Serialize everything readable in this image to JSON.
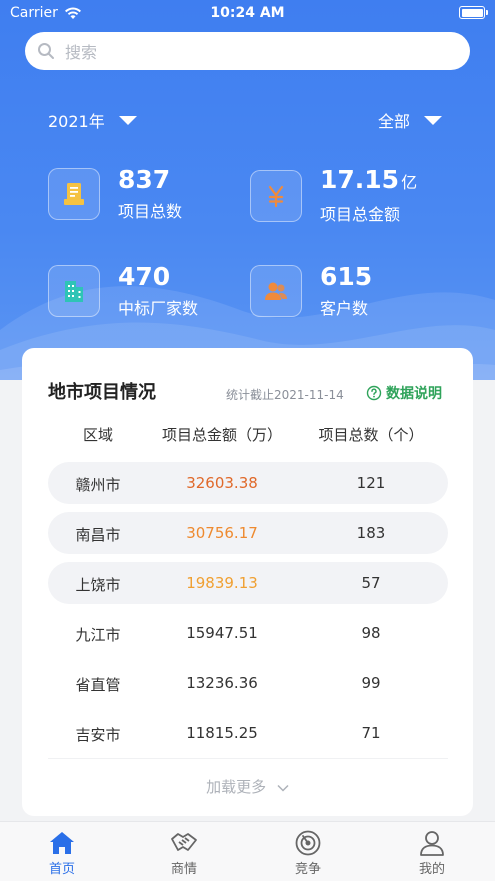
{
  "status_bar": {
    "carrier": "Carrier",
    "time": "10:24 AM"
  },
  "search": {
    "placeholder": "搜索"
  },
  "filters": {
    "year": "2021年",
    "scope": "全部"
  },
  "stats": [
    {
      "value": "837",
      "unit": "",
      "label": "项目总数",
      "icon": "document-icon",
      "color": "#f5c242"
    },
    {
      "value": "17.15",
      "unit": "亿",
      "label": "项目总金额",
      "icon": "yuan-icon",
      "color": "#f08a3c"
    },
    {
      "value": "470",
      "unit": "",
      "label": "中标厂家数",
      "icon": "building-icon",
      "color": "#2ec4b6"
    },
    {
      "value": "615",
      "unit": "",
      "label": "客户数",
      "icon": "users-icon",
      "color": "#f08a3c"
    }
  ],
  "card": {
    "title": "地市项目情况",
    "date": "统计截止2021-11-14",
    "help": "数据说明",
    "columns": [
      "区域",
      "项目总金额（万）",
      "项目总数（个）"
    ],
    "rows": [
      {
        "region": "赣州市",
        "amount": "32603.38",
        "count": "121"
      },
      {
        "region": "南昌市",
        "amount": "30756.17",
        "count": "183"
      },
      {
        "region": "上饶市",
        "amount": "19839.13",
        "count": "57"
      },
      {
        "region": "九江市",
        "amount": "15947.51",
        "count": "98"
      },
      {
        "region": "省直管",
        "amount": "13236.36",
        "count": "99"
      },
      {
        "region": "吉安市",
        "amount": "11815.25",
        "count": "71"
      }
    ],
    "load_more": "加载更多"
  },
  "tabs": [
    {
      "label": "首页",
      "icon": "home-icon",
      "active": true
    },
    {
      "label": "商情",
      "icon": "handshake-icon",
      "active": false
    },
    {
      "label": "竞争",
      "icon": "target-icon",
      "active": false
    },
    {
      "label": "我的",
      "icon": "person-icon",
      "active": false
    }
  ],
  "colors": {
    "accent": "#2a6fe8",
    "amount_top": "#e0692a",
    "amount_mid": "#ee8a2f",
    "amount_third": "#f0a032",
    "help_green": "#2fa35a"
  }
}
